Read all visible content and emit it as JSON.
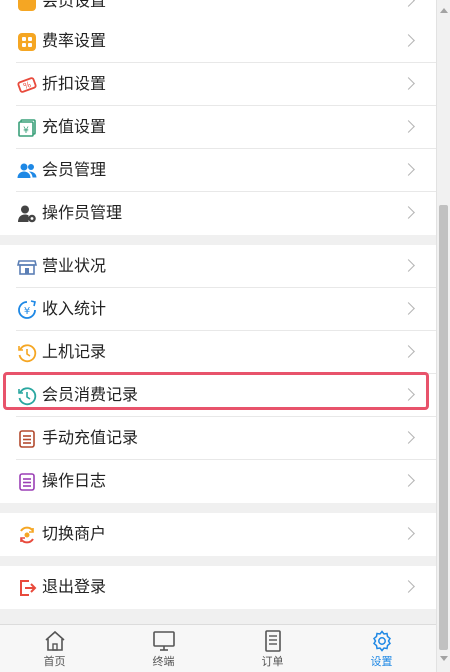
{
  "menu": {
    "top_partial": {
      "label": "会员设置"
    },
    "group1": [
      {
        "label": "费率设置",
        "icon": "rate-grid-icon"
      },
      {
        "label": "折扣设置",
        "icon": "discount-ticket-icon"
      },
      {
        "label": "充值设置",
        "icon": "recharge-yen-icon"
      },
      {
        "label": "会员管理",
        "icon": "members-icon"
      },
      {
        "label": "操作员管理",
        "icon": "operator-gear-icon"
      }
    ],
    "group2": [
      {
        "label": "营业状况",
        "icon": "shop-icon"
      },
      {
        "label": "收入统计",
        "icon": "income-yen-icon"
      },
      {
        "label": "上机记录",
        "icon": "history-clock-orange-icon"
      },
      {
        "label": "会员消费记录",
        "icon": "history-clock-teal-icon",
        "highlighted": true
      },
      {
        "label": "手动充值记录",
        "icon": "record-list-icon"
      },
      {
        "label": "操作日志",
        "icon": "log-list-icon"
      }
    ],
    "group3": [
      {
        "label": "切换商户",
        "icon": "switch-merchant-icon"
      }
    ],
    "group4": [
      {
        "label": "退出登录",
        "icon": "logout-icon"
      }
    ]
  },
  "tabbar": {
    "tabs": [
      {
        "label": "首页",
        "icon": "home-icon"
      },
      {
        "label": "终端",
        "icon": "monitor-icon"
      },
      {
        "label": "订单",
        "icon": "document-icon"
      },
      {
        "label": "设置",
        "icon": "gear-icon",
        "active": true
      }
    ]
  },
  "colors": {
    "highlight_border": "#e8536b",
    "active_tab": "#1e88e5",
    "orange": "#f5a623",
    "red": "#e84a3c",
    "blue": "#1e88e5",
    "purple": "#9b3fb5"
  }
}
